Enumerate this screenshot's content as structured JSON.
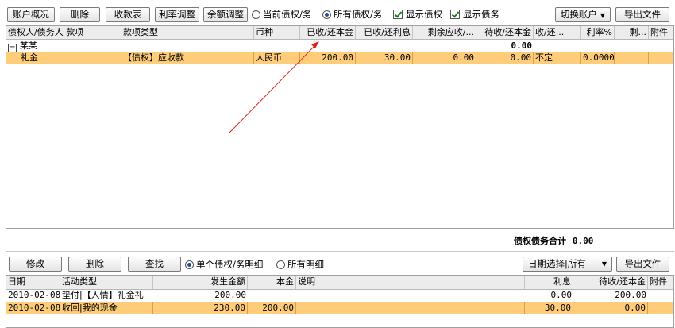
{
  "toolbar": {
    "account_overview": "账户概况",
    "delete": "删除",
    "receipt_table": "收款表",
    "rate_adjust": "利率调整",
    "balance_adjust": "余额调整",
    "opt_current": "当前债权/务",
    "opt_all": "所有债权/务",
    "show_credit": "显示债权",
    "show_debt": "显示债务",
    "switch_account": "切换账户",
    "export": "导出文件"
  },
  "top_table": {
    "columns": [
      "债权人/债务人 款项",
      "款项类型",
      "币种",
      "已收/还本金",
      "已收/还利息",
      "剩余应收/...",
      "待收/还本金",
      "收/还...",
      "利率%",
      "剩...",
      "附件"
    ],
    "group": {
      "name": "某某",
      "total": "0.00"
    },
    "rows": [
      [
        "礼金",
        "【债权】应收款",
        "人民币",
        "200.00",
        "30.00",
        "0.00",
        "0.00",
        "不定",
        "0.0000",
        "",
        ""
      ]
    ]
  },
  "summary": {
    "label": "债权债务合计",
    "value": "0.00"
  },
  "bottom_toolbar": {
    "modify": "修改",
    "delete": "删除",
    "find": "查找",
    "opt_single": "单个债权/务明细",
    "opt_all": "所有明细",
    "date_select": "日期选择|所有",
    "export": "导出文件"
  },
  "bottom_table": {
    "columns": [
      "日期",
      "活动类型",
      "发生金额",
      "本金",
      "说明",
      "利息",
      "待收/还本金",
      "附件"
    ],
    "rows": [
      [
        "2010-02-08",
        "垫付|【人情】礼金礼",
        "200.00",
        "",
        "",
        "0.00",
        "200.00",
        ""
      ],
      [
        "2010-02-08",
        "收回|我的现金",
        "230.00",
        "200.00",
        "",
        "30.00",
        "0.00",
        ""
      ]
    ]
  },
  "colors": {
    "selected_row": "#ffcc7a",
    "annotation_arrow": "#e02020"
  }
}
